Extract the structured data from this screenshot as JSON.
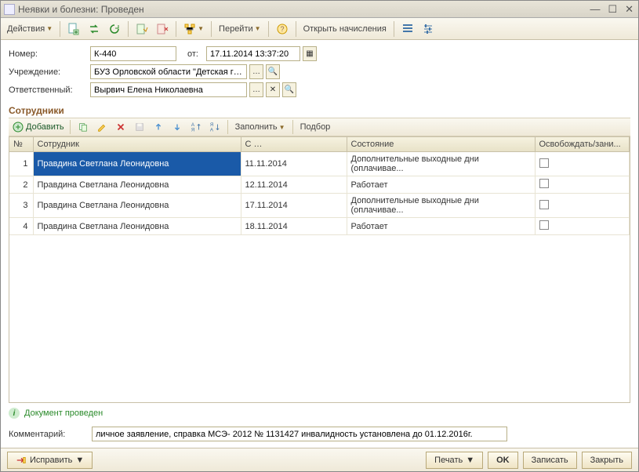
{
  "window": {
    "title": "Неявки и болезни: Проведен"
  },
  "toolbar": {
    "actions": "Действия",
    "goto": "Перейти",
    "open_charges": "Открыть начисления"
  },
  "form": {
    "number_label": "Номер:",
    "number": "К-440",
    "from_label": "от:",
    "date": "17.11.2014 13:37:20",
    "org_label": "Учреждение:",
    "org": "БУЗ Орловской области \"Детская г…",
    "resp_label": "Ответственный:",
    "resp": "Вырвич Елена Николаевна"
  },
  "section": {
    "employees": "Сотрудники"
  },
  "list_toolbar": {
    "add": "Добавить",
    "fill": "Заполнить",
    "pick": "Подбор"
  },
  "columns": {
    "n": "№",
    "emp": "Сотрудник",
    "from": "С …",
    "state": "Состояние",
    "release": "Освобождать/зани..."
  },
  "rows": [
    {
      "n": "1",
      "emp": "Правдина Светлана Леонидовна",
      "from": "11.11.2014",
      "state": "Дополнительные выходные дни (оплачивае...",
      "cb": false
    },
    {
      "n": "2",
      "emp": "Правдина Светлана Леонидовна",
      "from": "12.11.2014",
      "state": "Работает",
      "cb": false
    },
    {
      "n": "3",
      "emp": "Правдина Светлана Леонидовна",
      "from": "17.11.2014",
      "state": "Дополнительные выходные дни (оплачивае...",
      "cb": false
    },
    {
      "n": "4",
      "emp": "Правдина Светлана Леонидовна",
      "from": "18.11.2014",
      "state": "Работает",
      "cb": false
    }
  ],
  "status": {
    "text": "Документ проведен"
  },
  "comment": {
    "label": "Комментарий:",
    "value": "личное заявление, справка МСЭ- 2012 № 1131427 инвалидность установлена до 01.12.2016г."
  },
  "buttons": {
    "fix": "Исправить",
    "print": "Печать",
    "ok": "OK",
    "write": "Записать",
    "close": "Закрыть"
  }
}
